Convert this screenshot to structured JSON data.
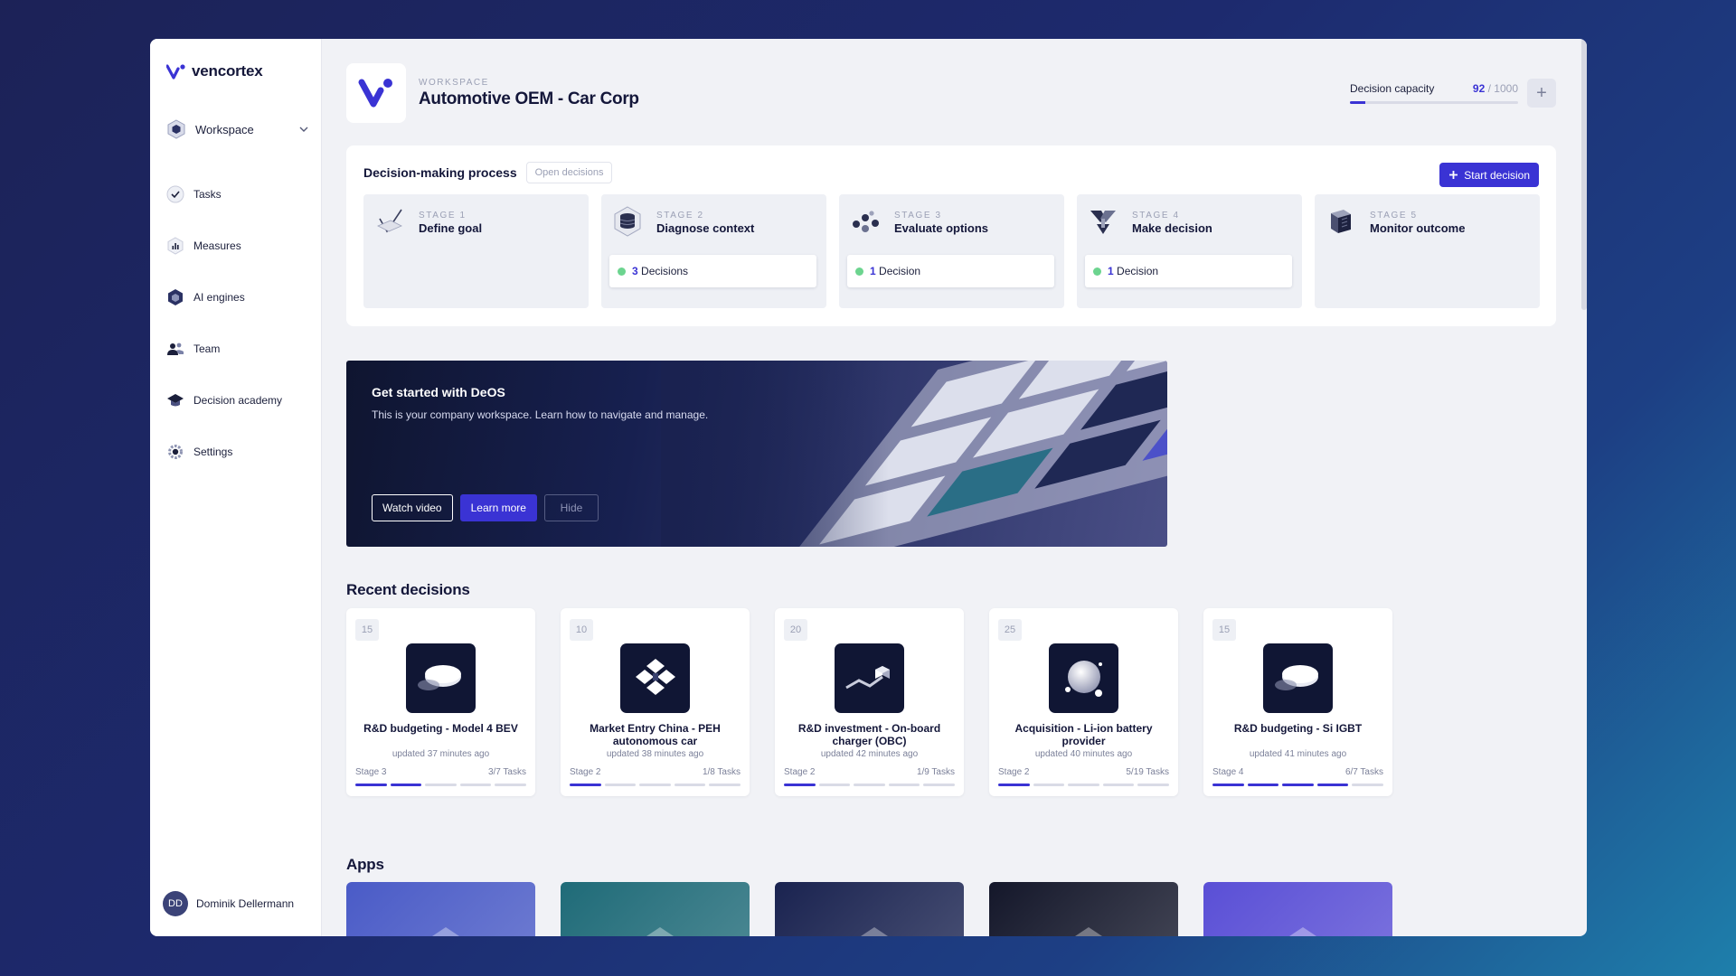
{
  "brand": {
    "name": "vencortex"
  },
  "sidebar": {
    "workspace_label": "Workspace",
    "items": [
      {
        "label": "Tasks",
        "icon": "check-circle-icon"
      },
      {
        "label": "Measures",
        "icon": "bar-chart-icon"
      },
      {
        "label": "AI engines",
        "icon": "hexagon-icon"
      },
      {
        "label": "Team",
        "icon": "team-icon"
      },
      {
        "label": "Decision academy",
        "icon": "graduation-cap-icon"
      },
      {
        "label": "Settings",
        "icon": "gear-icon"
      }
    ],
    "user": {
      "initials": "DD",
      "name": "Dominik Dellermann"
    }
  },
  "header": {
    "eyebrow": "WORKSPACE",
    "title": "Automotive OEM - Car Corp",
    "capacity": {
      "label": "Decision capacity",
      "used": "92",
      "separator": "/",
      "total": "1000",
      "fraction": 0.092
    }
  },
  "process": {
    "title": "Decision-making process",
    "open_label": "Open decisions",
    "start_label": "Start decision",
    "stages": [
      {
        "num": "STAGE 1",
        "name": "Define goal",
        "badge": null
      },
      {
        "num": "STAGE 2",
        "name": "Diagnose context",
        "badge": {
          "count": "3",
          "label": "Decisions"
        }
      },
      {
        "num": "STAGE 3",
        "name": "Evaluate options",
        "badge": {
          "count": "1",
          "label": "Decision"
        }
      },
      {
        "num": "STAGE 4",
        "name": "Make decision",
        "badge": {
          "count": "1",
          "label": "Decision"
        }
      },
      {
        "num": "STAGE 5",
        "name": "Monitor outcome",
        "badge": null
      }
    ]
  },
  "banner": {
    "title": "Get started with DeOS",
    "subtitle": "This is your company workspace. Learn how to navigate and manage.",
    "watch_label": "Watch video",
    "learn_label": "Learn more",
    "hide_label": "Hide"
  },
  "recent": {
    "title": "Recent decisions",
    "cards": [
      {
        "count": "15",
        "title": "R&D budgeting - Model 4 BEV",
        "updated": "updated 37 minutes ago",
        "stage": "Stage 3",
        "tasks": "3/7 Tasks",
        "progress": 2,
        "art": "disc"
      },
      {
        "count": "10",
        "title": "Market Entry China - PEH autonomous car",
        "updated": "updated 38 minutes ago",
        "stage": "Stage 2",
        "tasks": "1/8 Tasks",
        "progress": 1,
        "art": "diamonds"
      },
      {
        "count": "20",
        "title": "R&D investment - On-board charger (OBC)",
        "updated": "updated 42 minutes ago",
        "stage": "Stage 2",
        "tasks": "1/9 Tasks",
        "progress": 1,
        "art": "path"
      },
      {
        "count": "25",
        "title": "Acquisition - Li-ion battery provider",
        "updated": "updated 40 minutes ago",
        "stage": "Stage 2",
        "tasks": "5/19 Tasks",
        "progress": 1,
        "art": "sphere"
      },
      {
        "count": "15",
        "title": "R&D budgeting - Si IGBT",
        "updated": "updated 41 minutes ago",
        "stage": "Stage 4",
        "tasks": "6/7 Tasks",
        "progress": 4,
        "art": "disc"
      }
    ]
  },
  "apps": {
    "title": "Apps",
    "colors": [
      "#4a5bc7",
      "#1f6b78",
      "#1a2350",
      "#14172a",
      "#5a4fd6"
    ]
  }
}
